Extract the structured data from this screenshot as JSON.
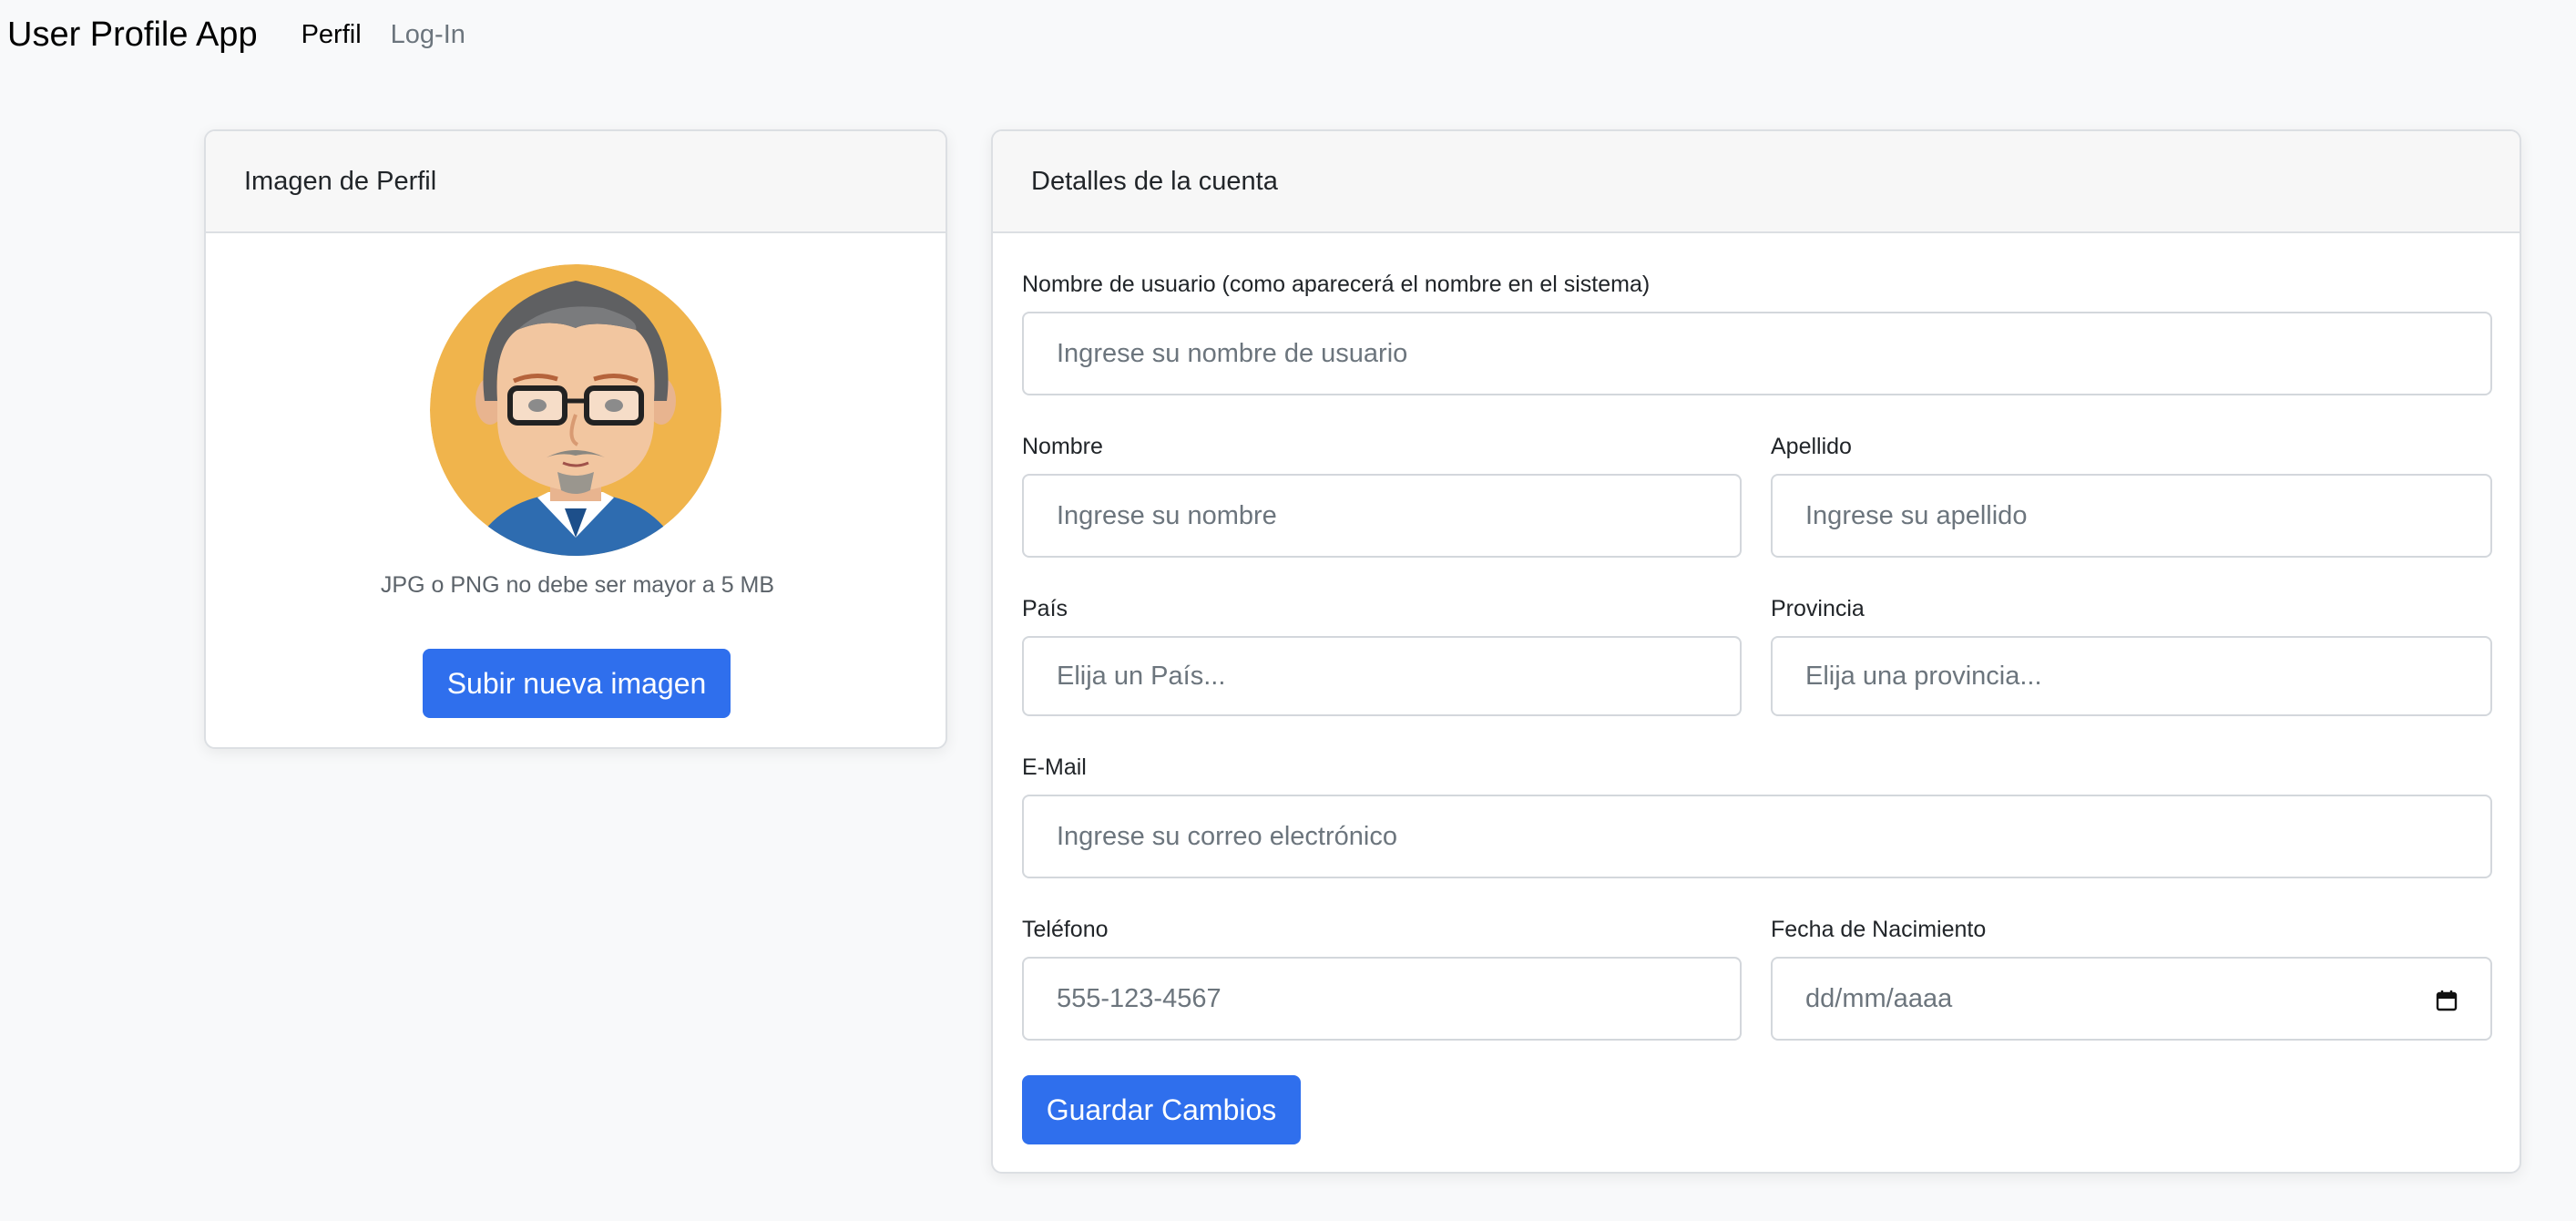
{
  "navbar": {
    "brand": "User Profile App",
    "links": [
      {
        "label": "Perfil",
        "active": true
      },
      {
        "label": "Log-In",
        "active": false
      }
    ]
  },
  "profile_card": {
    "title": "Imagen de Perfil",
    "avatar_icon": "cartoon-man-avatar",
    "hint": "JPG o PNG no debe ser mayor a 5 MB",
    "upload_label": "Subir nueva imagen"
  },
  "account_card": {
    "title": "Detalles de la cuenta",
    "fields": {
      "username": {
        "label": "Nombre de usuario (como aparecerá el nombre en el sistema)",
        "placeholder": "Ingrese su nombre de usuario"
      },
      "first_name": {
        "label": "Nombre",
        "placeholder": "Ingrese su nombre"
      },
      "last_name": {
        "label": "Apellido",
        "placeholder": "Ingrese su apellido"
      },
      "country": {
        "label": "País",
        "placeholder": "Elija un País..."
      },
      "province": {
        "label": "Provincia",
        "placeholder": "Elija una provincia..."
      },
      "email": {
        "label": "E-Mail",
        "placeholder": "Ingrese su correo electrónico"
      },
      "phone": {
        "label": "Teléfono",
        "placeholder": "555-123-4567"
      },
      "birthdate": {
        "label": "Fecha de Nacimiento",
        "placeholder": "dd/mm/aaaa",
        "icon": "calendar-icon"
      }
    },
    "save_label": "Guardar Cambios"
  },
  "colors": {
    "primary": "#2f6fed",
    "page_bg": "#f8f9fa",
    "header_bg": "#f7f7f7",
    "avatar_bg": "#f0b44c"
  }
}
